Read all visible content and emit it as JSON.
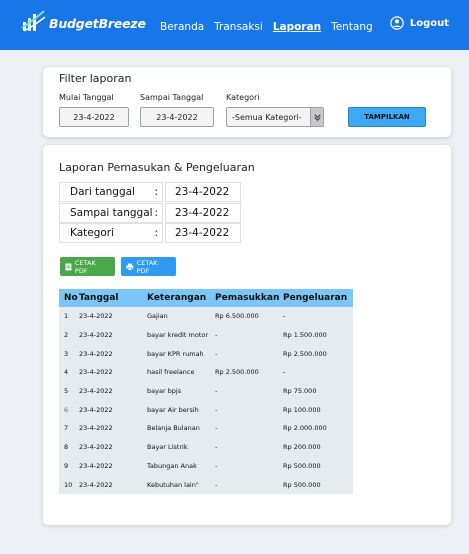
{
  "header": {
    "brand": "BudgetBreeze",
    "nav": [
      {
        "label": "Beranda",
        "active": false
      },
      {
        "label": "Transaksi",
        "active": false
      },
      {
        "label": "Laporan",
        "active": true
      },
      {
        "label": "Tentang",
        "active": false
      }
    ],
    "logout_label": "Logout",
    "colors": {
      "bar": "#1877e8"
    }
  },
  "filter": {
    "title": "Filter laporan",
    "start_label": "Mulai Tanggal",
    "start_value": "23-4-2022",
    "end_label": "Sampai Tanggal",
    "end_value": "23-4-2022",
    "category_label": "Kategori",
    "category_value": "-Semua Kategori-",
    "show_button": "TAMPILKAN"
  },
  "report": {
    "title": "Laporan Pemasukan  & Pengeluaran",
    "info": [
      {
        "label": "Dari tanggal",
        "value": "23-4-2022"
      },
      {
        "label": "Sampai tanggal",
        "value": "23-4-2022"
      },
      {
        "label": "Kategori",
        "value": "23-4-2022"
      }
    ],
    "separator": ":",
    "pdf_button_1": "CETAK PDF",
    "pdf_button_2": "CETAK PDF",
    "columns": [
      "No",
      "Tanggal",
      "Keterangan",
      "Pemasukkan",
      "Pengeluaran"
    ],
    "rows": [
      [
        "1",
        "23-4-2022",
        "Gajian",
        "Rp 6.500.000",
        "-"
      ],
      [
        "2",
        "23-4-2022",
        "bayar kredit motor",
        "-",
        "Rp 1.500.000"
      ],
      [
        "3",
        "23-4-2022",
        "bayar KPR rumah",
        "-",
        "Rp 2.500.000"
      ],
      [
        "4",
        "23-4-2022",
        "hasil freelance",
        "Rp 2.500.000",
        "-"
      ],
      [
        "5",
        "23-4-2022",
        "bayar bpjs",
        "-",
        "Rp 75.000"
      ],
      [
        "6",
        "23-4-2022",
        "bayar Air bersih",
        "-",
        "Rp 100.000"
      ],
      [
        "7",
        "23-4-2022",
        "Belanja Bulanan",
        "-",
        "Rp 2.000.000"
      ],
      [
        "8",
        "23-4-2022",
        "Bayar Listrik",
        "-",
        "Rp 200.000"
      ],
      [
        "9",
        "23-4-2022",
        "Tabungan Anak",
        "-",
        "Rp 500.000"
      ],
      [
        "10",
        "23-4-2022",
        "Kebutuhan lain\"",
        "-",
        "Rp 500.000"
      ]
    ]
  }
}
